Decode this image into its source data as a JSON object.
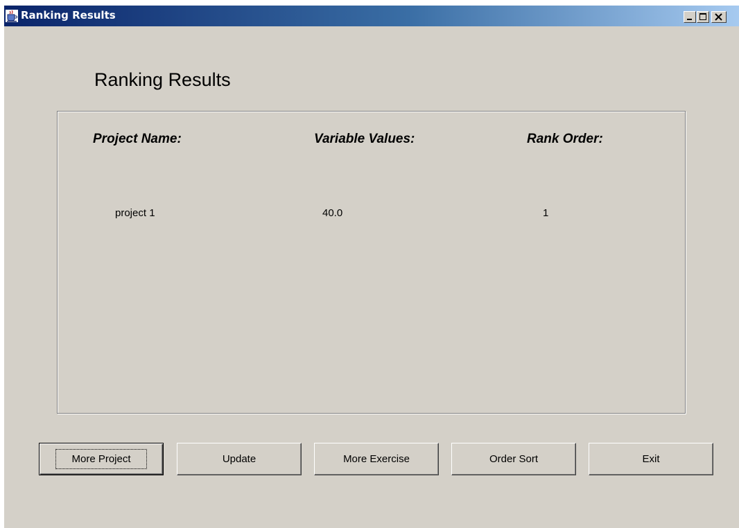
{
  "window": {
    "title": "Ranking Results",
    "controls": {
      "minimize": "minimize",
      "maximize": "maximize",
      "close": "close"
    }
  },
  "main": {
    "heading": "Ranking Results",
    "table": {
      "columns": [
        "Project Name:",
        "Variable Values:",
        "Rank Order:"
      ],
      "rows": [
        [
          "project 1",
          "40.0",
          "1"
        ]
      ]
    }
  },
  "buttons": {
    "more_project": "More Project",
    "update": "Update",
    "more_exercise": "More Exercise",
    "order_sort": "Order Sort",
    "exit": "Exit"
  },
  "icons": {
    "app": "java-cup-icon",
    "minimize": "minimize-icon",
    "maximize": "maximize-icon",
    "close": "close-icon"
  },
  "colors": {
    "titlebar_start": "#0a246a",
    "titlebar_end": "#a6caf0",
    "window_bg": "#d4d0c8"
  }
}
